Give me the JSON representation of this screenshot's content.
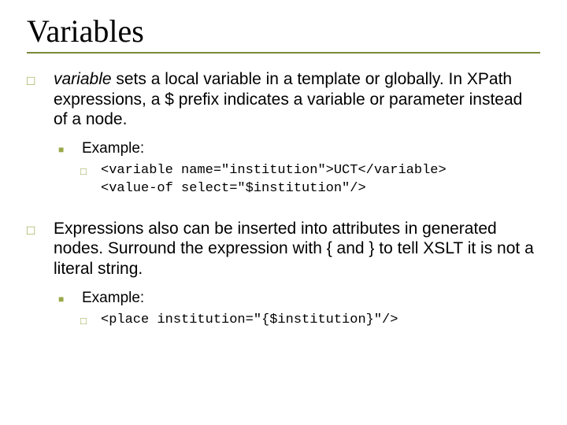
{
  "title": "Variables",
  "items": [
    {
      "text_pre_italic": "variable",
      "text_rest": " sets a local variable in a template or globally. In XPath expressions, a $ prefix indicates a variable or parameter instead of a node.",
      "example_label": "Example:",
      "code": "<variable name=\"institution\">UCT</variable>\n<value-of select=\"$institution\"/>"
    },
    {
      "text_pre_italic": "",
      "text_rest": "Expressions also can be inserted into attributes in generated nodes.  Surround the expression with { and } to tell XSLT it is not a literal string.",
      "example_label": "Example:",
      "code": "<place institution=\"{$institution}\"/>"
    }
  ]
}
